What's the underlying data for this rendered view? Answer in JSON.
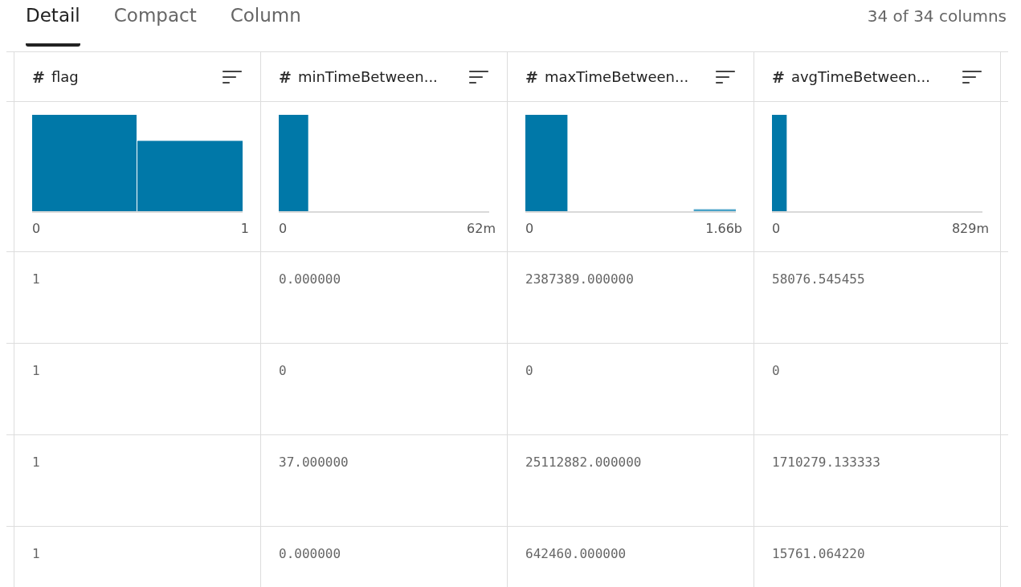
{
  "tabs": [
    {
      "label": "Detail",
      "selected": true
    },
    {
      "label": "Compact",
      "selected": false
    },
    {
      "label": "Column",
      "selected": false
    }
  ],
  "column_count": "34 of 34 columns",
  "table": {
    "columns": [
      {
        "type_symbol": "#",
        "name": "flag",
        "histogram": {
          "min_label": "0",
          "max_label": "1"
        }
      },
      {
        "type_symbol": "#",
        "name": "minTimeBetween...",
        "histogram": {
          "min_label": "0",
          "max_label": "62m"
        }
      },
      {
        "type_symbol": "#",
        "name": "maxTimeBetween...",
        "histogram": {
          "min_label": "0",
          "max_label": "1.66b"
        }
      },
      {
        "type_symbol": "#",
        "name": "avgTimeBetween...",
        "histogram": {
          "min_label": "0",
          "max_label": "829m"
        }
      }
    ],
    "rows": [
      [
        "1",
        "0.000000",
        "2387389.000000",
        "58076.545455"
      ],
      [
        "1",
        "0",
        "0",
        "0"
      ],
      [
        "1",
        "37.000000",
        "25112882.000000",
        "1710279.133333"
      ],
      [
        "1",
        "0.000000",
        "642460.000000",
        "15761.064220"
      ]
    ]
  }
}
